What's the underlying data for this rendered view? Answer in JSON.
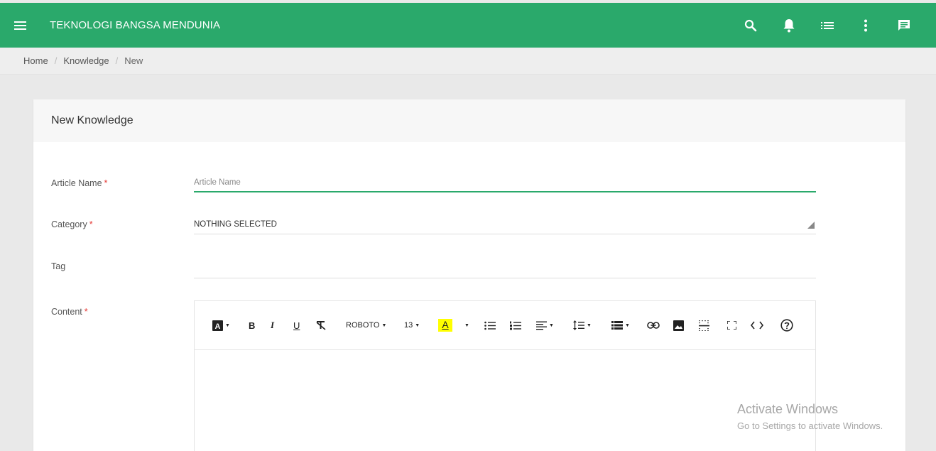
{
  "header": {
    "app_title": "TEKNOLOGI BANGSA MENDUNIA",
    "bg_color": "#2aa96b",
    "icons": [
      "menu-icon",
      "search-icon",
      "bell-icon",
      "list-icon",
      "more-vert-icon",
      "chat-icon"
    ]
  },
  "breadcrumb": {
    "items": [
      "Home",
      "Knowledge",
      "New"
    ],
    "separator": "/"
  },
  "card": {
    "title": "New Knowledge"
  },
  "form": {
    "required_mark": "*",
    "article_name": {
      "label": "Article Name",
      "placeholder": "Article Name",
      "value": ""
    },
    "category": {
      "label": "Category",
      "value": "NOTHING SELECTED"
    },
    "tag": {
      "label": "Tag",
      "value": ""
    },
    "content": {
      "label": "Content"
    }
  },
  "editor_toolbar": {
    "font_name": "ROBOTO",
    "font_size": "13",
    "highlight_color": "#ffff00",
    "tools": [
      "style",
      "bold",
      "italic",
      "underline",
      "clear-format",
      "font-family",
      "font-size",
      "color",
      "unordered-list",
      "ordered-list",
      "paragraph",
      "line-height",
      "table",
      "link",
      "picture",
      "hr",
      "fullscreen",
      "codeview",
      "help"
    ],
    "labels": {
      "bold": "B",
      "italic": "I",
      "underline": "U",
      "style": "A",
      "color": "A"
    }
  },
  "watermark": {
    "line1": "Activate Windows",
    "line2": "Go to Settings to activate Windows."
  }
}
